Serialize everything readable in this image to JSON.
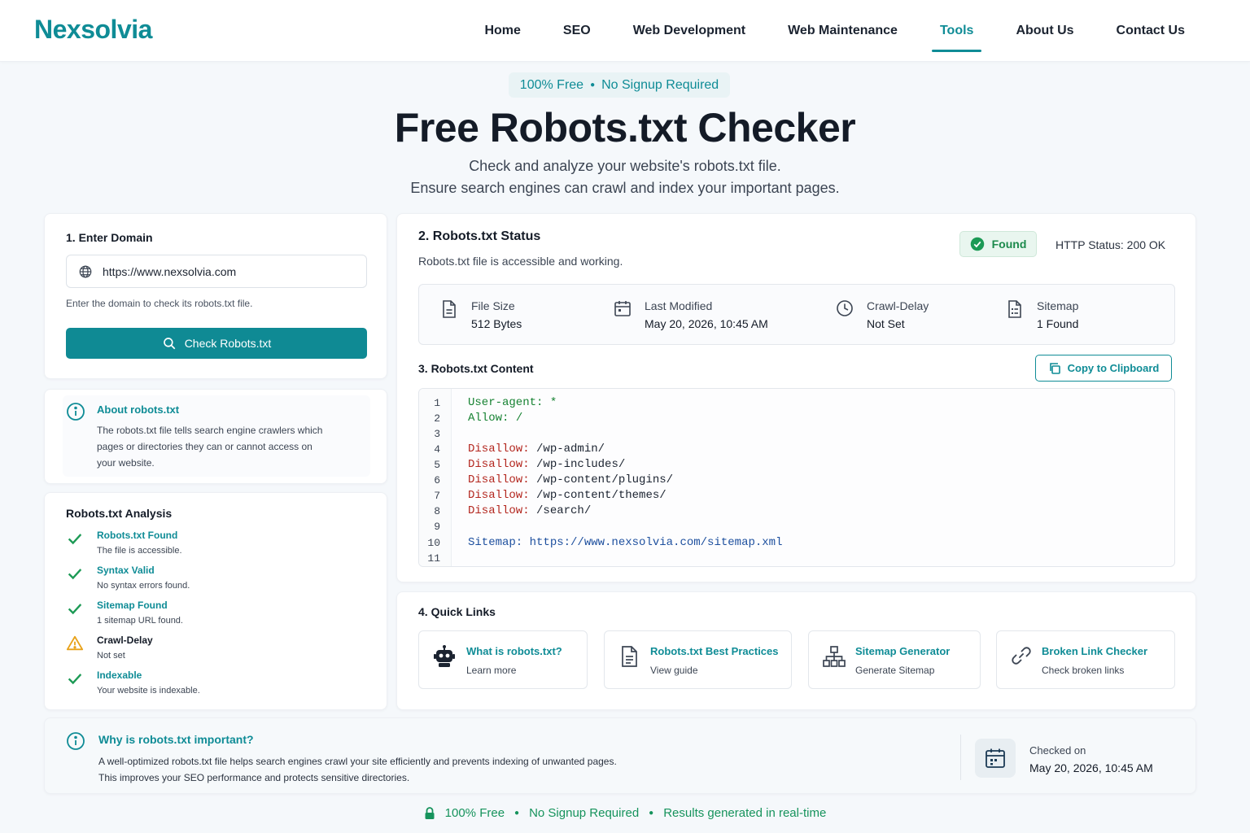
{
  "header": {
    "logo": "Nexsolvia",
    "nav": [
      {
        "label": "Home"
      },
      {
        "label": "SEO"
      },
      {
        "label": "Web Development"
      },
      {
        "label": "Web Maintenance"
      },
      {
        "label": "Tools",
        "active": true
      },
      {
        "label": "About Us"
      },
      {
        "label": "Contact Us"
      }
    ]
  },
  "hero": {
    "badge_left": "100% Free",
    "badge_right": "No Signup Required",
    "title": "Free Robots.txt Checker",
    "subtitle_1": "Check and analyze your website's robots.txt file.",
    "subtitle_2": "Ensure search engines can crawl and index your important pages."
  },
  "domain": {
    "title": "1. Enter Domain",
    "value": "https://www.nexsolvia.com",
    "hint": "Enter the domain to check its robots.txt file.",
    "button": "Check Robots.txt"
  },
  "about": {
    "title": "About robots.txt",
    "text": "The robots.txt file tells search engine crawlers which pages or directories they can or cannot access on your website."
  },
  "analysis": {
    "title": "Robots.txt Analysis",
    "items": [
      {
        "title": "Robots.txt Found",
        "desc": "The file is accessible.",
        "icon": "check-icon"
      },
      {
        "title": "Syntax Valid",
        "desc": "No syntax errors found.",
        "icon": "check-icon"
      },
      {
        "title": "Sitemap Found",
        "desc": "1 sitemap URL found.",
        "icon": "check-icon"
      },
      {
        "title": "Crawl-Delay",
        "desc": "Not set",
        "icon": "warning-icon"
      },
      {
        "title": "Indexable",
        "desc": "Your website is indexable.",
        "icon": "check-icon"
      }
    ]
  },
  "status": {
    "title": "2. Robots.txt Status",
    "subtitle": "Robots.txt file is accessible and working.",
    "badge": "Found",
    "http": "HTTP Status: 200 OK",
    "stats": [
      {
        "label": "File Size",
        "value": "512 Bytes",
        "icon": "file-icon"
      },
      {
        "label": "Last Modified",
        "value": "May 20, 2026, 10:45 AM",
        "icon": "calendar-icon"
      },
      {
        "label": "Crawl-Delay",
        "value": "Not Set",
        "icon": "clock-icon"
      },
      {
        "label": "Sitemap",
        "value": "1 Found",
        "icon": "sitemap-file-icon"
      }
    ]
  },
  "content": {
    "title": "3. Robots.txt Content",
    "copy": "Copy to Clipboard",
    "lines": [
      {
        "n": "1",
        "k": "User-agent:",
        "v": " *",
        "type": "green"
      },
      {
        "n": "2",
        "k": "Allow:",
        "v": " /",
        "type": "green"
      },
      {
        "n": "3",
        "k": "",
        "v": "",
        "type": "plain"
      },
      {
        "n": "4",
        "k": "Disallow:",
        "v": " /wp-admin/",
        "type": "red"
      },
      {
        "n": "5",
        "k": "Disallow:",
        "v": " /wp-includes/",
        "type": "red"
      },
      {
        "n": "6",
        "k": "Disallow:",
        "v": " /wp-content/plugins/",
        "type": "red"
      },
      {
        "n": "7",
        "k": "Disallow:",
        "v": " /wp-content/themes/",
        "type": "red"
      },
      {
        "n": "8",
        "k": "Disallow:",
        "v": " /search/",
        "type": "red"
      },
      {
        "n": "9",
        "k": "",
        "v": "",
        "type": "plain"
      },
      {
        "n": "10",
        "k": "Sitemap:",
        "v": " https://www.nexsolvia.com/sitemap.xml",
        "type": "blue"
      },
      {
        "n": "11",
        "k": "",
        "v": "",
        "type": "plain"
      }
    ]
  },
  "quick": {
    "title": "4. Quick Links",
    "links": [
      {
        "title": "What is robots.txt?",
        "sub": "Learn more",
        "icon": "robot-icon"
      },
      {
        "title": "Robots.txt Best Practices",
        "sub": "View guide",
        "icon": "document-icon"
      },
      {
        "title": "Sitemap Generator",
        "sub": "Generate Sitemap",
        "icon": "sitemap-icon"
      },
      {
        "title": "Broken Link Checker",
        "sub": "Check broken links",
        "icon": "link-icon"
      }
    ]
  },
  "why": {
    "title": "Why is robots.txt important?",
    "text_1": "A well-optimized robots.txt file helps search engines crawl your site efficiently and prevents indexing of unwanted pages.",
    "text_2": "This improves your SEO performance and protects sensitive directories.",
    "checked_label": "Checked on",
    "checked_value": "May 20, 2026, 10:45 AM"
  },
  "footer": {
    "item_1": "100% Free",
    "item_2": "No Signup Required",
    "item_3": "Results generated in real-time"
  },
  "colors": {
    "brand": "#0f8c96",
    "success": "#1c8a4c",
    "warning": "#e8a21a"
  }
}
